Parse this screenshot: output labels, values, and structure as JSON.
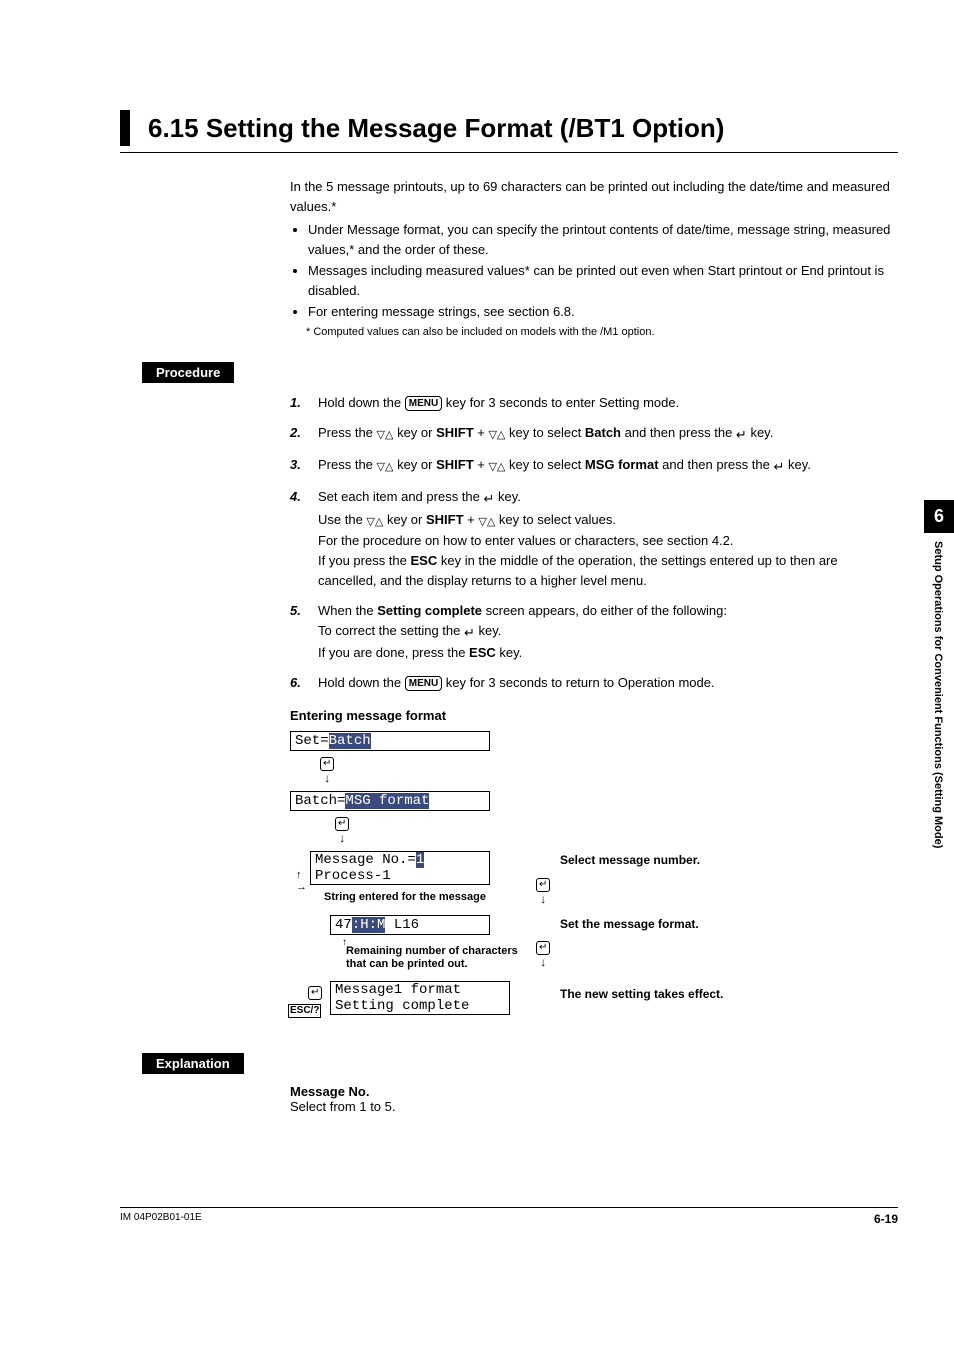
{
  "heading": "6.15  Setting the Message Format (/BT1 Option)",
  "intro1": "In the 5 message printouts, up to 69 characters can be printed out including the date/time and measured values.*",
  "bullets": [
    "Under Message format, you can specify the printout contents of date/time, message string, measured values,* and the order of these.",
    "Messages including measured values* can be printed out even when Start printout or End printout is disabled.",
    "For entering message strings, see section 6.8."
  ],
  "footnote": "*  Computed values can also be included on models with the /M1 option.",
  "procedure_label": "Procedure",
  "steps": {
    "1a": "Hold down the ",
    "1b": " key for 3 seconds to enter Setting mode.",
    "2a": "Press the ",
    "2b": " key or ",
    "2c": " + ",
    "2d": " key to select ",
    "2e": " and then press the ",
    "2f": " key.",
    "3a": "Press the ",
    "3b": " key or ",
    "3c": " + ",
    "3d": " key to select ",
    "3e": " and then press the ",
    "3f": " key.",
    "4a": "Set each item and press the ",
    "4b": " key.",
    "4c": "Use the ",
    "4d": " key or ",
    "4e": " + ",
    "4f": " key to select values.",
    "4g": "For the procedure on how to enter values or characters, see section 4.2.",
    "4h": "If you press the ",
    "4i": " key in the middle of the operation, the settings entered up to then are cancelled, and the display returns to a higher level menu.",
    "5a": "When the ",
    "5b": " screen appears, do either of the following:",
    "5c": "To correct the setting the ",
    "5d": " key.",
    "5e": "If you are done, press the ",
    "5f": " key.",
    "6a": "Hold down the ",
    "6b": " key for 3 seconds to return to Operation mode.",
    "menu": "MENU",
    "shift": "SHIFT",
    "esc": "ESC",
    "batch": "Batch",
    "msgfmt": "MSG format",
    "setcomp": "Setting complete"
  },
  "subhead": "Entering message format",
  "screens": {
    "set": "Set=",
    "set_hl": "Batch",
    "batch": "Batch=",
    "batch_hl": "MSG format",
    "msgno": "Message No.=",
    "msgno_hl": "1",
    "process": "Process-1",
    "fmt_a": "47",
    "fmt_hl": ":H:M",
    "fmt_b": " L16",
    "final1": "Message1 format",
    "final2": "Setting complete"
  },
  "captions": {
    "selmsg": "Select message number.",
    "strentered": "String entered for the message",
    "setfmt": "Set the message format.",
    "remaining": "Remaining number of characters that can be printed out.",
    "takeseffect": "The new setting takes effect.",
    "escq": "ESC/?"
  },
  "explanation_label": "Explanation",
  "explain_head": "Message No.",
  "explain_body": "Select from 1 to 5.",
  "side_num": "6",
  "side_text": "Setup Operations for Convenient Functions (Setting Mode)",
  "footer_left": "IM 04P02B01-01E",
  "footer_right": "6-19"
}
